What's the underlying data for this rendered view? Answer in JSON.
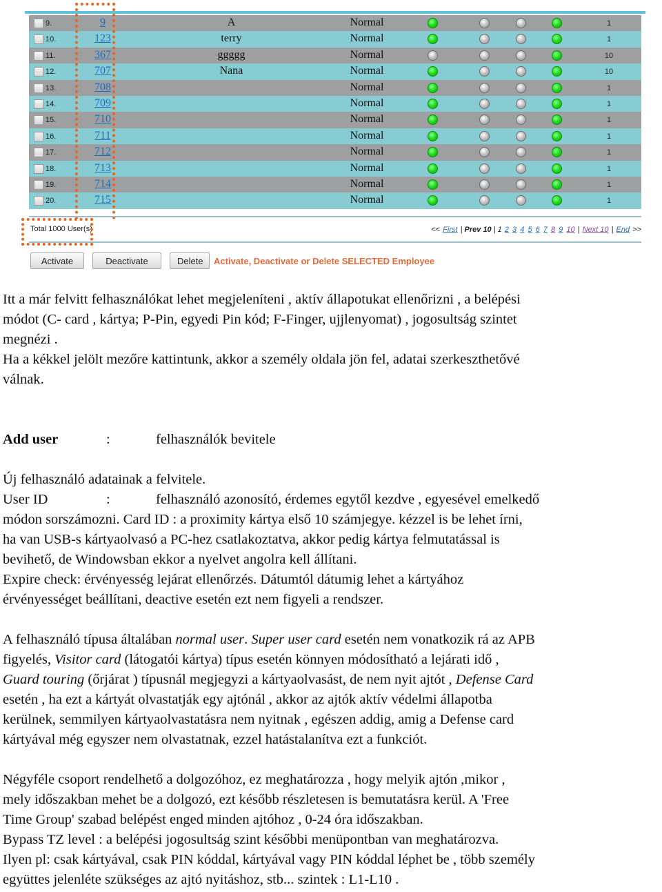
{
  "table": {
    "rows": [
      {
        "index": "9.",
        "user_id": "9",
        "name": "A",
        "type": "Normal",
        "leds": [
          true,
          false,
          false,
          true
        ],
        "level": "1"
      },
      {
        "index": "10.",
        "user_id": "123",
        "name": "terry",
        "type": "Normal",
        "leds": [
          true,
          false,
          false,
          true
        ],
        "level": "1"
      },
      {
        "index": "11.",
        "user_id": "367",
        "name": "ggggg",
        "type": "Normal",
        "leds": [
          false,
          false,
          false,
          true
        ],
        "level": "10"
      },
      {
        "index": "12.",
        "user_id": "707",
        "name": "Nana",
        "type": "Normal",
        "leds": [
          true,
          false,
          false,
          true
        ],
        "level": "10"
      },
      {
        "index": "13.",
        "user_id": "708",
        "name": "",
        "type": "Normal",
        "leds": [
          true,
          false,
          false,
          true
        ],
        "level": "1"
      },
      {
        "index": "14.",
        "user_id": "709",
        "name": "",
        "type": "Normal",
        "leds": [
          true,
          false,
          false,
          true
        ],
        "level": "1"
      },
      {
        "index": "15.",
        "user_id": "710",
        "name": "",
        "type": "Normal",
        "leds": [
          true,
          false,
          false,
          true
        ],
        "level": "1"
      },
      {
        "index": "16.",
        "user_id": "711",
        "name": "",
        "type": "Normal",
        "leds": [
          true,
          false,
          false,
          true
        ],
        "level": "1"
      },
      {
        "index": "17.",
        "user_id": "712",
        "name": "",
        "type": "Normal",
        "leds": [
          true,
          false,
          false,
          true
        ],
        "level": "1"
      },
      {
        "index": "18.",
        "user_id": "713",
        "name": "",
        "type": "Normal",
        "leds": [
          true,
          false,
          false,
          true
        ],
        "level": "1"
      },
      {
        "index": "19.",
        "user_id": "714",
        "name": "",
        "type": "Normal",
        "leds": [
          true,
          false,
          false,
          true
        ],
        "level": "1"
      },
      {
        "index": "20.",
        "user_id": "715",
        "name": "",
        "type": "Normal",
        "leds": [
          true,
          false,
          false,
          true
        ],
        "level": "1"
      }
    ],
    "colors": {
      "row_gray": "#9e9fa1",
      "row_teal": "#88ccd3",
      "led_on": "#22e022",
      "led_off": "#c4c4c4",
      "link": "#1a6fc0",
      "highlight": "#e8651e"
    }
  },
  "footer": {
    "total": "Total 1000 User(s)",
    "pager": {
      "first_prefix": "<<",
      "first": "First",
      "prev": "Prev 10",
      "current_page": "1",
      "pages": [
        "2",
        "3",
        "4",
        "5",
        "6",
        "7",
        "8",
        "9",
        "10"
      ],
      "next": "Next 10",
      "end": "End",
      "end_suffix": ">>",
      "sep": "|"
    }
  },
  "actions": {
    "activate": "Activate",
    "deactivate": "Deactivate",
    "delete": "Delete",
    "note": "Activate, Deactivate or Delete SELECTED Employee"
  },
  "doc": {
    "p1_l1": "Itt a már felvitt felhasználókat lehet megjeleníteni , aktív állapotukat ellenőrizni , a belépési",
    "p1_l2": "módot (C- card , kártya; P-Pin, egyedi Pin kód; F-Finger, ujjlenyomat) , jogosultság szintet",
    "p1_l3": "megnézi .",
    "p1_l4": "Ha a kékkel jelölt mezőre kattintunk, akkor a személy oldala jön fel, adatai szerkeszthetővé",
    "p1_l5": "válnak.",
    "add_user_key": "Add user",
    "colon": ":",
    "add_user_val": "felhasználók bevitele",
    "new_user": "Új felhasználó adatainak a felvitele.",
    "user_id_key": "User ID",
    "user_id_val": "felhasználó azonosító, érdemes egytől  kezdve , egyesével emelkedő",
    "p2_l1": "módon sorszámozni. Card ID :  a proximity kártya első 10 számjegye. kézzel is be lehet írni,",
    "p2_l2": "ha van USB-s kártyaolvasó a PC-hez csatlakoztatva, akkor pedig kártya felmutatással is",
    "p2_l3": "bevihető, de Windowsban ekkor a nyelvet angolra kell állítani.",
    "p2_l4": "Expire check: érvényesség lejárat ellenőrzés. Dátumtól dátumig lehet a kártyához",
    "p2_l5": "érvényességet beállítani, deactive esetén ezt nem figyeli a rendszer.",
    "p3_a": "A felhasználó típusa általában ",
    "p3_normal_user": "normal user",
    "p3_b": ". ",
    "p3_super_user": "Super user card",
    "p3_c": " esetén nem vonatkozik rá az APB",
    "p3_d": "figyelés, ",
    "p3_visitor": "Visitor card",
    "p3_e": " (látogatói kártya) típus esetén könnyen módosítható a lejárati idő ,",
    "p3_guard": "Guard touring",
    "p3_f": " (őrjárat ) típusnál megjegyzi a kártyaolvasást, de nem nyit ajtót , ",
    "p3_defense": "Defense Card",
    "p3_l4": "esetén , ha ezt a kártyát olvastatják egy ajtónál , akkor az ajtók aktív védelmi állapotba",
    "p3_l5": "kerülnek, semmilyen kártyaolvastatásra nem nyitnak , egészen addig, amig a Defense card",
    "p3_l6": "kártyával még egyszer nem olvastatnak, ezzel hatástalanítva ezt a funkciót.",
    "p4_l1": "Négyféle csoport rendelhető a dolgozóhoz, ez meghatározza  , hogy melyik ajtón ,mikor ,",
    "p4_l2": "mely időszakban mehet be a dolgozó, ezt később részletesen is bemutatásra kerül. A 'Free",
    "p4_l3": "Time Group' szabad belépést enged minden ajtóhoz , 0-24 óra időszakban.",
    "p4_l4": "Bypass TZ level : a belépési jogosultság szint későbbi menüpontban van meghatározva.",
    "p4_l5": "Ilyen pl: csak kártyával, csak PIN kóddal, kártyával vagy PIN kóddal léphet be , több személy",
    "p4_l6": "együttes jelenléte szükséges az ajtó nyitáshoz, stb... szintek : L1-L10 ."
  }
}
